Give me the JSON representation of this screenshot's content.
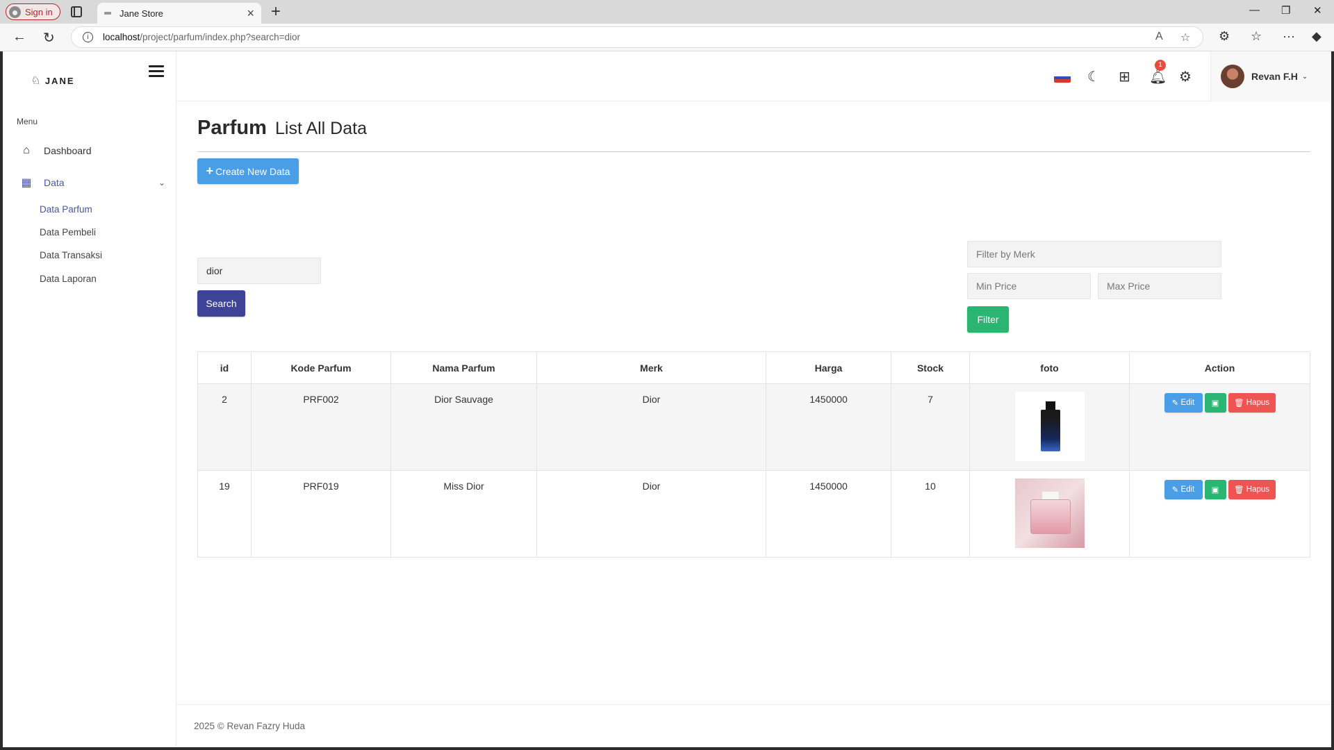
{
  "browser": {
    "signin_label": "Sign in",
    "tab_title": "Jane Store",
    "url_host": "localhost",
    "url_path": "/project/parfum/index.php?search=dior"
  },
  "sidebar": {
    "logo_text": "JANE",
    "menu_label": "Menu",
    "items": [
      {
        "label": "Dashboard",
        "icon": "home-icon"
      },
      {
        "label": "Data",
        "icon": "layout-icon"
      }
    ],
    "sub_items": [
      {
        "label": "Data Parfum"
      },
      {
        "label": "Data Pembeli"
      },
      {
        "label": "Data Transaksi"
      },
      {
        "label": "Data Laporan"
      }
    ]
  },
  "topbar": {
    "notification_count": "1",
    "user_name": "Revan F.H"
  },
  "page": {
    "title": "Parfum",
    "subtitle": "List All Data",
    "create_label": "Create New Data",
    "search_value": "dior",
    "search_label": "Search",
    "filter_merk_placeholder": "Filter by Merk",
    "min_price_placeholder": "Min Price",
    "max_price_placeholder": "Max Price",
    "filter_label": "Filter"
  },
  "table": {
    "headers": [
      "id",
      "Kode Parfum",
      "Nama Parfum",
      "Merk",
      "Harga",
      "Stock",
      "foto",
      "Action"
    ],
    "rows": [
      {
        "id": "2",
        "kode": "PRF002",
        "nama": "Dior Sauvage",
        "merk": "Dior",
        "harga": "1450000",
        "stock": "7"
      },
      {
        "id": "19",
        "kode": "PRF019",
        "nama": "Miss Dior",
        "merk": "Dior",
        "harga": "1450000",
        "stock": "10"
      }
    ],
    "edit_label": "Edit",
    "delete_label": "Hapus"
  },
  "footer": {
    "text": "2025 © Revan Fazry Huda"
  },
  "colors": {
    "primary": "#4a9ee6",
    "search": "#3e4396",
    "success": "#2ab573",
    "danger": "#ee5552",
    "accent": "#4a55a8"
  }
}
